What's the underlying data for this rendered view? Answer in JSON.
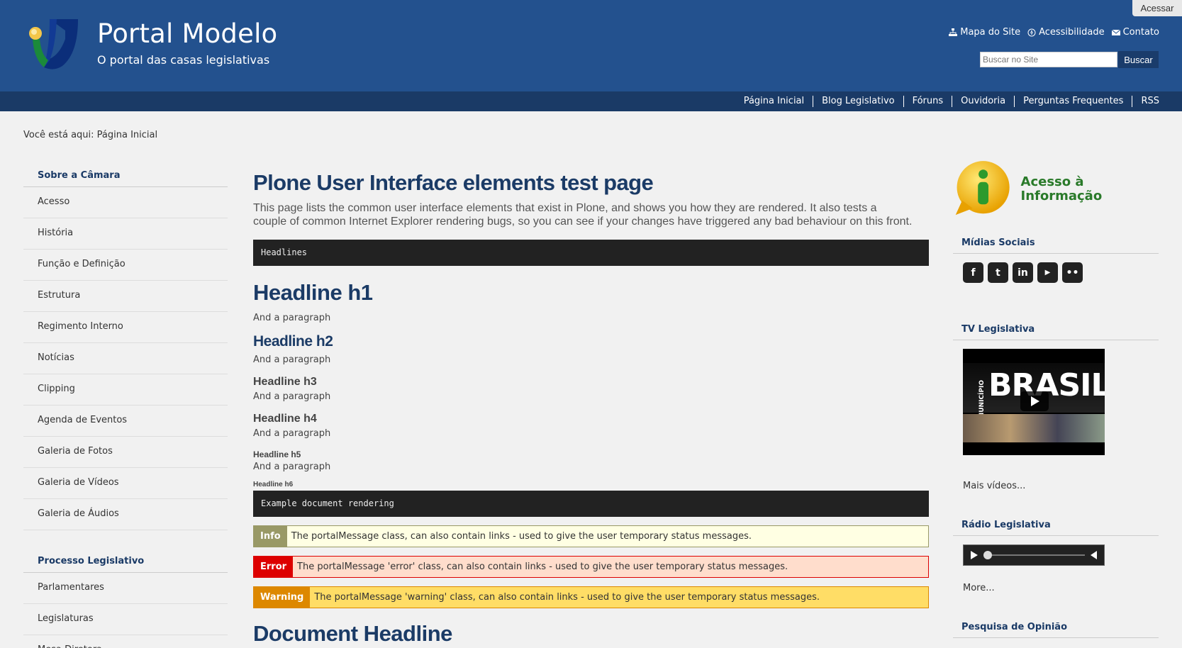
{
  "header": {
    "login": "Acessar",
    "title": "Portal Modelo",
    "subtitle": "O portal das casas legislativas",
    "actions": [
      "Mapa do Site",
      "Acessibilidade",
      "Contato"
    ],
    "search_placeholder": "Buscar no Site",
    "search_button": "Buscar"
  },
  "nav": [
    "Página Inicial",
    "Blog Legislativo",
    "Fóruns",
    "Ouvidoria",
    "Perguntas Frequentes",
    "RSS"
  ],
  "breadcrumb": {
    "prefix": "Você está aqui:",
    "current": "Página Inicial"
  },
  "sidebar": {
    "section1": "Sobre a Câmara",
    "items1": [
      "Acesso",
      "História",
      "Função e Definição",
      "Estrutura",
      "Regimento Interno",
      "Notícias",
      "Clipping",
      "Agenda de Eventos",
      "Galeria de Fotos",
      "Galeria de Vídeos",
      "Galeria de Áudios"
    ],
    "section2": "Processo Legislativo",
    "items2": [
      "Parlamentares",
      "Legislaturas",
      "Mesa Diretora"
    ]
  },
  "main": {
    "title": "Plone User Interface elements test page",
    "description": "This page lists the common user interface elements that exist in Plone, and shows you how they are rendered. It also tests a couple of common Internet Explorer rendering bugs, so you can see if your changes have triggered any bad behaviour on this front.",
    "pre1": "Headlines",
    "h1": "Headline h1",
    "h2": "Headline h2",
    "h3": "Headline h3",
    "h4": "Headline h4",
    "h5": "Headline h5",
    "h6": "Headline h6",
    "para": "And a paragraph",
    "pre2": "Example document rendering",
    "info_label": "Info",
    "info_pre": "The portalMessage class, can also contain",
    "info_post": "- used to give the user temporary status messages.",
    "error_label": "Error",
    "error_pre": "The portalMessage 'error' class, can also contain",
    "error_post": "- used to give the user temporary status messages.",
    "warning_label": "Warning",
    "warning_pre": "The portalMessage 'warning' class, can also contain",
    "warning_post": "- used to give the user temporary status messages.",
    "link_word": "links",
    "doc_headline": "Document Headline"
  },
  "right": {
    "acesso": "Acesso à Informação",
    "social_title": "Mídias Sociais",
    "tv_title": "TV Legislativa",
    "tv_brand": "BRASIL",
    "tv_side": "MUNICÍPIO",
    "more_videos": "Mais vídeos...",
    "radio_title": "Rádio Legislativa",
    "more": "More...",
    "poll_title": "Pesquisa de Opinião"
  }
}
